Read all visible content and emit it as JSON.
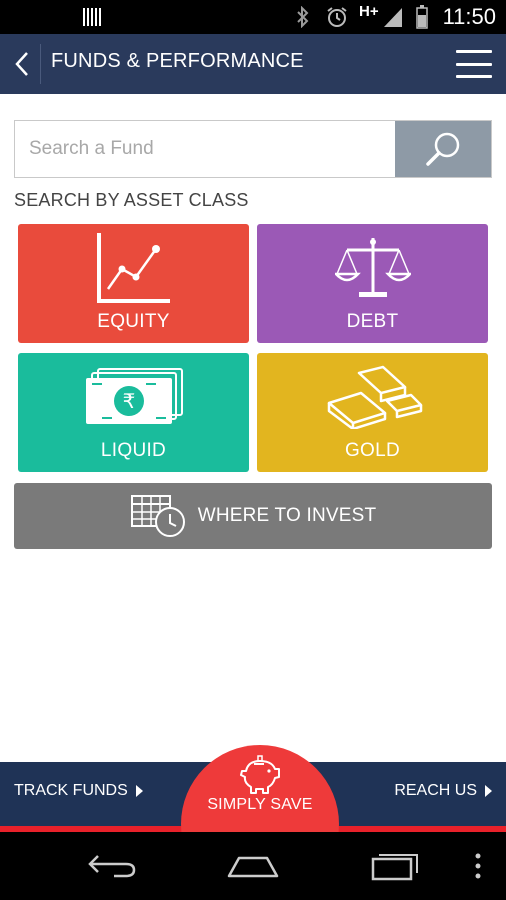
{
  "status_bar": {
    "network": "H+",
    "time": "11:50"
  },
  "header": {
    "title": "FUNDS & PERFORMANCE"
  },
  "search": {
    "placeholder": "Search a Fund"
  },
  "section_label": "SEARCH BY ASSET CLASS",
  "asset_classes": [
    {
      "label": "EQUITY",
      "color": "#e94b3c",
      "icon": "line-chart-icon"
    },
    {
      "label": "DEBT",
      "color": "#9b59b6",
      "icon": "balance-scale-icon"
    },
    {
      "label": "LIQUID",
      "color": "#1abc9c",
      "icon": "rupee-notes-icon"
    },
    {
      "label": "GOLD",
      "color": "#e2b51f",
      "icon": "gold-bars-icon"
    }
  ],
  "where_to_invest": {
    "label": "WHERE TO INVEST",
    "icon": "calendar-clock-icon"
  },
  "bottom_bar": {
    "track_label": "TRACK FUNDS",
    "save_label": "SIMPLY SAVE",
    "reach_label": "REACH US"
  },
  "colors": {
    "header": "#2a3a5c",
    "bottom_bar": "#1f3356",
    "save": "#ee3a3a",
    "search_button": "#8e9aa6",
    "where_button": "#7a7a7a"
  }
}
